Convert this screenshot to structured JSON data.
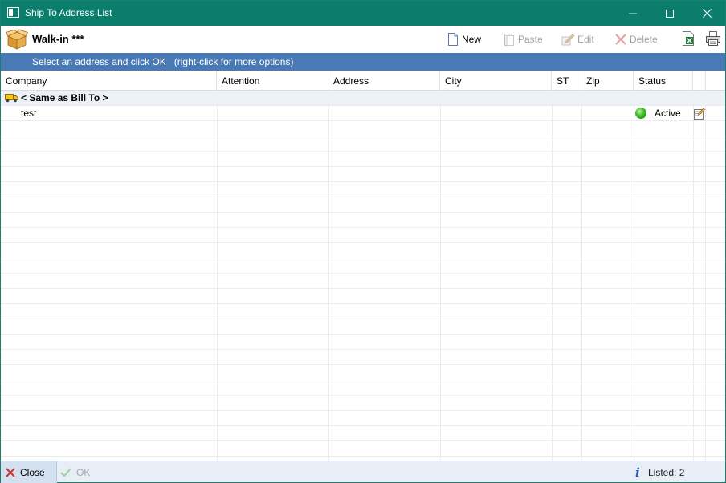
{
  "window": {
    "title": "Ship To Address List"
  },
  "toolbar": {
    "customer_name": "Walk-in ***",
    "new_label": "New",
    "paste_label": "Paste",
    "edit_label": "Edit",
    "delete_label": "Delete",
    "icons": [
      "box-icon",
      "new-document-icon",
      "paste-icon",
      "edit-icon",
      "delete-icon",
      "excel-icon",
      "print-icon"
    ]
  },
  "banner": {
    "text": "Select an address and click OK   (right-click for more options)"
  },
  "grid": {
    "columns": [
      "Company",
      "Attention",
      "Address",
      "City",
      "ST",
      "Zip",
      "Status"
    ],
    "rows": [
      {
        "company": "< Same as Bill To >",
        "attention": "",
        "address": "",
        "city": "",
        "st": "",
        "zip": "",
        "status": ""
      },
      {
        "company": "test",
        "attention": "",
        "address": "",
        "city": "",
        "st": "",
        "zip": "",
        "status": "Active"
      }
    ]
  },
  "footer": {
    "close_label": "Close",
    "ok_label": "OK",
    "listed_text": "Listed: 2"
  },
  "colors": {
    "titlebar": "#0a7d6c",
    "banner": "#4a7ab5",
    "same_as_row": "#ecf1f8",
    "active_status": "#3dbb21",
    "close_icon": "#d32f2f"
  }
}
